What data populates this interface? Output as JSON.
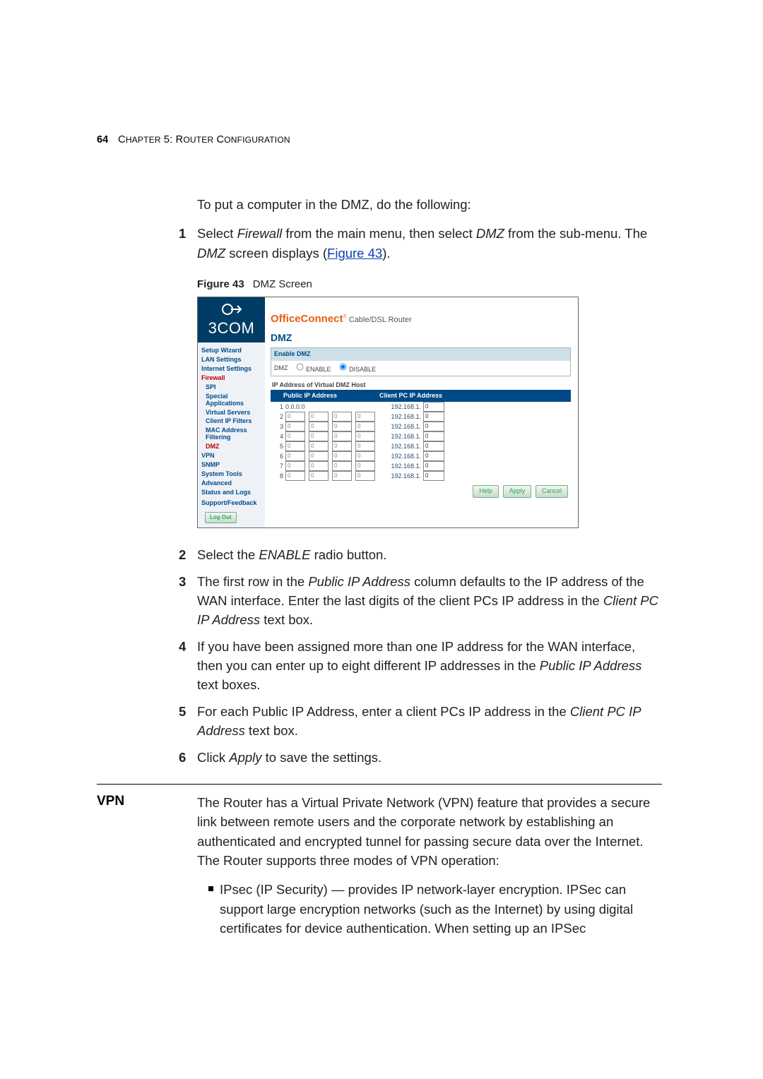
{
  "header": {
    "page_number": "64",
    "chapter_prefix": "C",
    "chapter_rest": "HAPTER",
    "chapter_num": " 5: R",
    "chapter_rest2": "OUTER",
    "chapter_rest3": " C",
    "chapter_rest4": "ONFIGURATION"
  },
  "intro": "To put a computer in the DMZ, do the following:",
  "step1_a": "Select ",
  "step1_i1": "Firewall",
  "step1_b": " from the main menu, then select ",
  "step1_i2": "DMZ",
  "step1_c": " from the sub-menu. The ",
  "step1_i3": "DMZ",
  "step1_d": " screen displays (",
  "step1_link": "Figure 43",
  "step1_e": ").",
  "figure": {
    "num": "Figure 43",
    "caption": "DMZ Screen"
  },
  "screenshot": {
    "brand": "3COM",
    "title_brand": "OfficeConnect",
    "title_tm": "®",
    "title_sub": " Cable/DSL Router",
    "nav": {
      "setup_wizard": "Setup Wizard",
      "lan_settings": "LAN Settings",
      "internet_settings": "Internet Settings",
      "firewall": "Firewall",
      "spi": "SPI",
      "spec_apps": "Special Applications",
      "virt_servers": "Virtual Servers",
      "client_ip": "Client IP Filters",
      "mac_filter": "MAC Address Filtering",
      "dmz": "DMZ",
      "vpn": "VPN",
      "snmp": "SNMP",
      "system_tools": "System Tools",
      "advanced": "Advanced",
      "status_logs": "Status and Logs",
      "support": "Support/Feedback",
      "logout": "Log Out"
    },
    "panel": {
      "h1": "DMZ",
      "enable_hdr": "Enable DMZ",
      "dmz_label": "DMZ",
      "enable": "ENABLE",
      "disable": "DISABLE",
      "host_label": "IP Address of Virtual DMZ Host",
      "col_public": "Public IP Address",
      "col_client": "Client PC IP Address",
      "row1_public": "0.0.0.0",
      "client_prefix": "192.168.1.",
      "placeholder": "0",
      "rows": [
        "1",
        "2",
        "3",
        "4",
        "5",
        "6",
        "7",
        "8"
      ]
    },
    "buttons": {
      "help": "Help",
      "apply": "Apply",
      "cancel": "Cancel"
    }
  },
  "step2_a": "Select the ",
  "step2_i": "ENABLE",
  "step2_b": " radio button.",
  "step3_a": "The first row in the ",
  "step3_i1": "Public IP Address",
  "step3_b": " column defaults to the IP address of the WAN interface. Enter the last digits of the client PCs IP address in the ",
  "step3_i2": "Client PC IP Address",
  "step3_c": " text box.",
  "step4_a": "If you have been assigned more than one IP address for the WAN interface, then you can enter up to eight different IP addresses in the ",
  "step4_i": "Public IP Address",
  "step4_b": " text boxes.",
  "step5_a": "For each Public IP Address, enter a client PCs IP address in the ",
  "step5_i": "Client PC IP Address",
  "step5_b": " text box.",
  "step6_a": "Click ",
  "step6_i": "Apply",
  "step6_b": " to save the settings.",
  "vpn": {
    "heading": "VPN",
    "para": "The Router has a Virtual Private Network (VPN) feature that provides a secure link between remote users and the corporate network by establishing an authenticated and encrypted tunnel for passing secure data over the Internet. The Router supports three modes of VPN operation:",
    "bullet1": "IPsec (IP Security) — provides IP network-layer encryption. IPSec can support large encryption networks (such as the Internet) by using digital certificates for device authentication. When setting up an IPSec"
  }
}
